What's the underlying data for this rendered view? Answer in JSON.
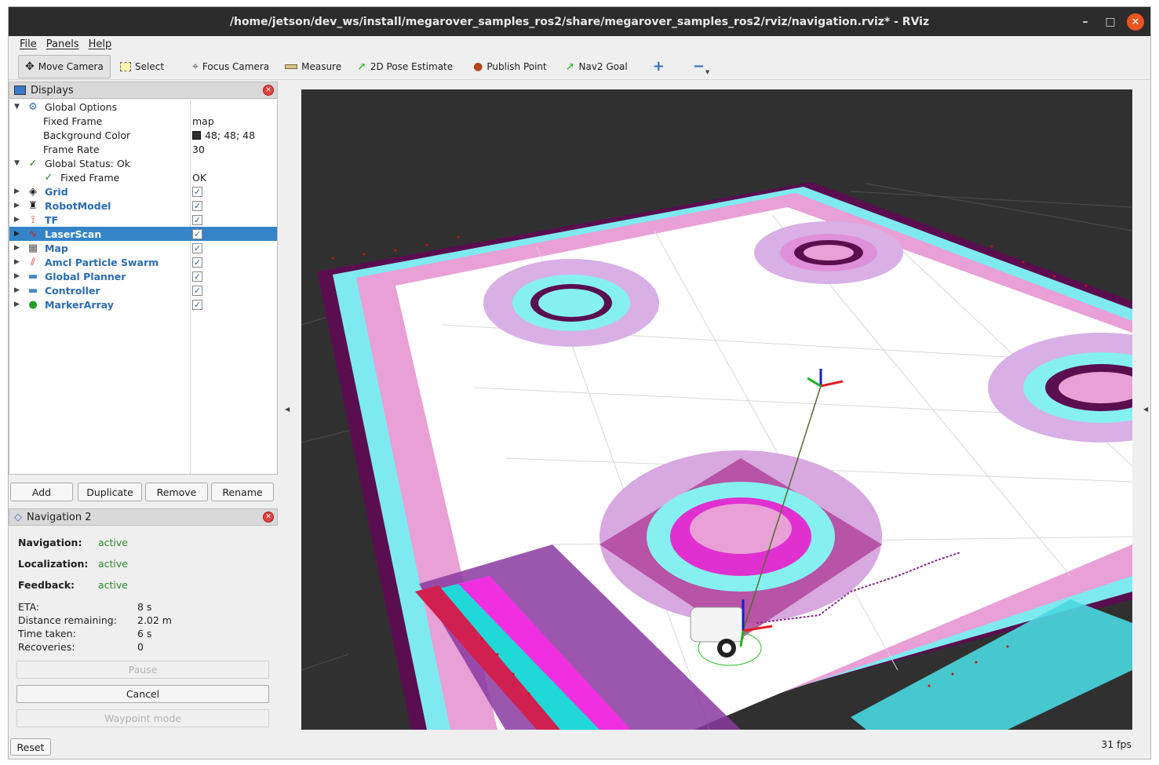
{
  "window": {
    "title": "/home/jetson/dev_ws/install/megarover_samples_ros2/share/megarover_samples_ros2/rviz/navigation.rviz* - RViz",
    "btn_min": "–",
    "btn_max": "□",
    "btn_close": "✕"
  },
  "menu": [
    "File",
    "Panels",
    "Help"
  ],
  "toolbar": {
    "move_camera": "Move Camera",
    "select": "Select",
    "focus_camera": "Focus Camera",
    "measure": "Measure",
    "pose_estimate": "2D Pose Estimate",
    "publish_point": "Publish Point",
    "nav2_goal": "Nav2 Goal",
    "add_tool": "+",
    "remove_tool": "−"
  },
  "displays": {
    "title": "Displays",
    "close": "✕",
    "global_options": "Global Options",
    "fixed_frame_label": "Fixed Frame",
    "fixed_frame_value": "map",
    "bg_color_label": "Background Color",
    "bg_color_value": "48; 48; 48",
    "bg_color_hex": "#303030",
    "frame_rate_label": "Frame Rate",
    "frame_rate_value": "30",
    "global_status": "Global Status: Ok",
    "status_fixed_frame": "Fixed Frame",
    "status_fixed_frame_value": "OK",
    "items": [
      {
        "name": "Grid",
        "checked": "✓"
      },
      {
        "name": "RobotModel",
        "checked": "✓"
      },
      {
        "name": "TF",
        "checked": "✓"
      },
      {
        "name": "LaserScan",
        "checked": "✓"
      },
      {
        "name": "Map",
        "checked": "✓"
      },
      {
        "name": "Amcl Particle Swarm",
        "checked": "✓"
      },
      {
        "name": "Global Planner",
        "checked": "✓"
      },
      {
        "name": "Controller",
        "checked": "✓"
      },
      {
        "name": "MarkerArray",
        "checked": "✓"
      }
    ],
    "buttons": {
      "add": "Add",
      "duplicate": "Duplicate",
      "remove": "Remove",
      "rename": "Rename"
    }
  },
  "navigation": {
    "title": "Navigation 2",
    "close": "✕",
    "navigation_label": "Navigation:",
    "navigation_value": "active",
    "localization_label": "Localization:",
    "localization_value": "active",
    "feedback_label": "Feedback:",
    "feedback_value": "active",
    "eta_label": "ETA:",
    "eta_value": "8 s",
    "distance_label": "Distance remaining:",
    "distance_value": "2.02 m",
    "time_label": "Time taken:",
    "time_value": "6 s",
    "recoveries_label": "Recoveries:",
    "recoveries_value": "0",
    "pause": "Pause",
    "cancel": "Cancel",
    "waypoint": "Waypoint mode"
  },
  "statusbar": {
    "reset": "Reset",
    "fps": "31 fps"
  },
  "colors": {
    "selection": "#3584c8",
    "active_green": "#2a8a2a",
    "titlebar": "#2c2c2c",
    "close_orange": "#e95420"
  }
}
